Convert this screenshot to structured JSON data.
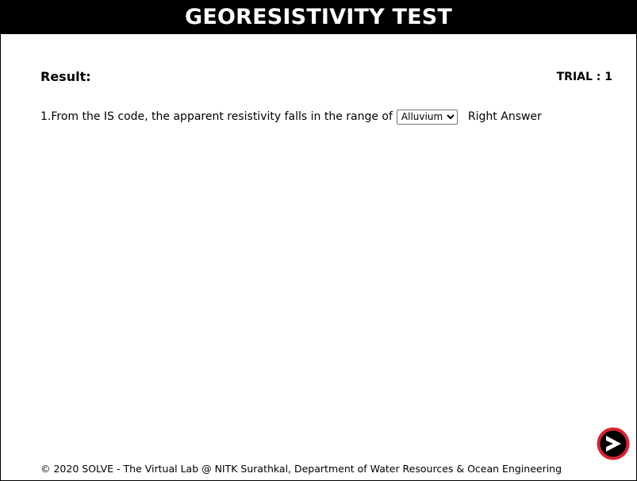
{
  "header": {
    "title": "GEORESISTIVITY TEST"
  },
  "result": {
    "label": "Result:",
    "trial": "TRIAL : 1"
  },
  "question": {
    "text": "1.From the IS code, the apparent resistivity falls in the range of",
    "selected": "Alluvium",
    "feedback": "Right Answer"
  },
  "next_button": {
    "icon": "arrow-right-icon",
    "ring_color": "#d9232e",
    "fill_color": "#000000",
    "arrow_color": "#ffffff"
  },
  "footer": {
    "text": "© 2020 SOLVE - The Virtual Lab @ NITK Surathkal, Department of Water Resources & Ocean Engineering"
  },
  "colors": {
    "header_bg": "#000000",
    "header_text": "#ffffff",
    "page_bg": "#ffffff"
  }
}
